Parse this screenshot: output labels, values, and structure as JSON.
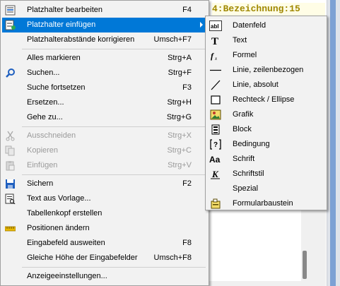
{
  "background": {
    "code_text": "4:Bezeichnung:15"
  },
  "main_menu": {
    "items": [
      {
        "label": "Platzhalter bearbeiten",
        "shortcut": "F4",
        "icon": "edit-placeholder-icon"
      },
      {
        "label": "Platzhalter einfügen",
        "shortcut": "",
        "icon": "insert-placeholder-icon"
      },
      {
        "label": "Platzhalterabstände korrigieren",
        "shortcut": "Umsch+F7",
        "icon": ""
      },
      {
        "label": "Alles markieren",
        "shortcut": "Strg+A",
        "icon": ""
      },
      {
        "label": "Suchen...",
        "shortcut": "Strg+F",
        "icon": "search-icon"
      },
      {
        "label": "Suche fortsetzen",
        "shortcut": "F3",
        "icon": ""
      },
      {
        "label": "Ersetzen...",
        "shortcut": "Strg+H",
        "icon": ""
      },
      {
        "label": "Gehe zu...",
        "shortcut": "Strg+G",
        "icon": ""
      },
      {
        "label": "Ausschneiden",
        "shortcut": "Strg+X",
        "icon": "cut-icon"
      },
      {
        "label": "Kopieren",
        "shortcut": "Strg+C",
        "icon": "copy-icon"
      },
      {
        "label": "Einfügen",
        "shortcut": "Strg+V",
        "icon": "paste-icon"
      },
      {
        "label": "Sichern",
        "shortcut": "F2",
        "icon": "save-icon"
      },
      {
        "label": "Text aus Vorlage...",
        "shortcut": "",
        "icon": "template-icon"
      },
      {
        "label": "Tabellenkopf erstellen",
        "shortcut": "",
        "icon": ""
      },
      {
        "label": "Positionen ändern",
        "shortcut": "",
        "icon": "ruler-icon"
      },
      {
        "label": "Eingabefeld ausweiten",
        "shortcut": "F8",
        "icon": ""
      },
      {
        "label": "Gleiche Höhe der Eingabefelder",
        "shortcut": "Umsch+F8",
        "icon": ""
      },
      {
        "label": "Anzeigeeinstellungen...",
        "shortcut": "",
        "icon": ""
      }
    ]
  },
  "sub_menu": {
    "items": [
      {
        "label": "Datenfeld",
        "icon": "data-field-icon"
      },
      {
        "label": "Text",
        "icon": "text-icon"
      },
      {
        "label": "Formel",
        "icon": "formula-icon"
      },
      {
        "label": "Linie, zeilenbezogen",
        "icon": "line-row-icon"
      },
      {
        "label": "Linie, absolut",
        "icon": "line-absolute-icon"
      },
      {
        "label": "Rechteck / Ellipse",
        "icon": "rectangle-icon"
      },
      {
        "label": "Grafik",
        "icon": "image-icon"
      },
      {
        "label": "Block",
        "icon": "block-icon"
      },
      {
        "label": "Bedingung",
        "icon": "condition-icon"
      },
      {
        "label": "Schrift",
        "icon": "font-icon"
      },
      {
        "label": "Schriftstil",
        "icon": "font-style-icon"
      },
      {
        "label": "Spezial",
        "icon": ""
      },
      {
        "label": "Formularbaustein",
        "icon": "form-module-icon"
      }
    ]
  }
}
